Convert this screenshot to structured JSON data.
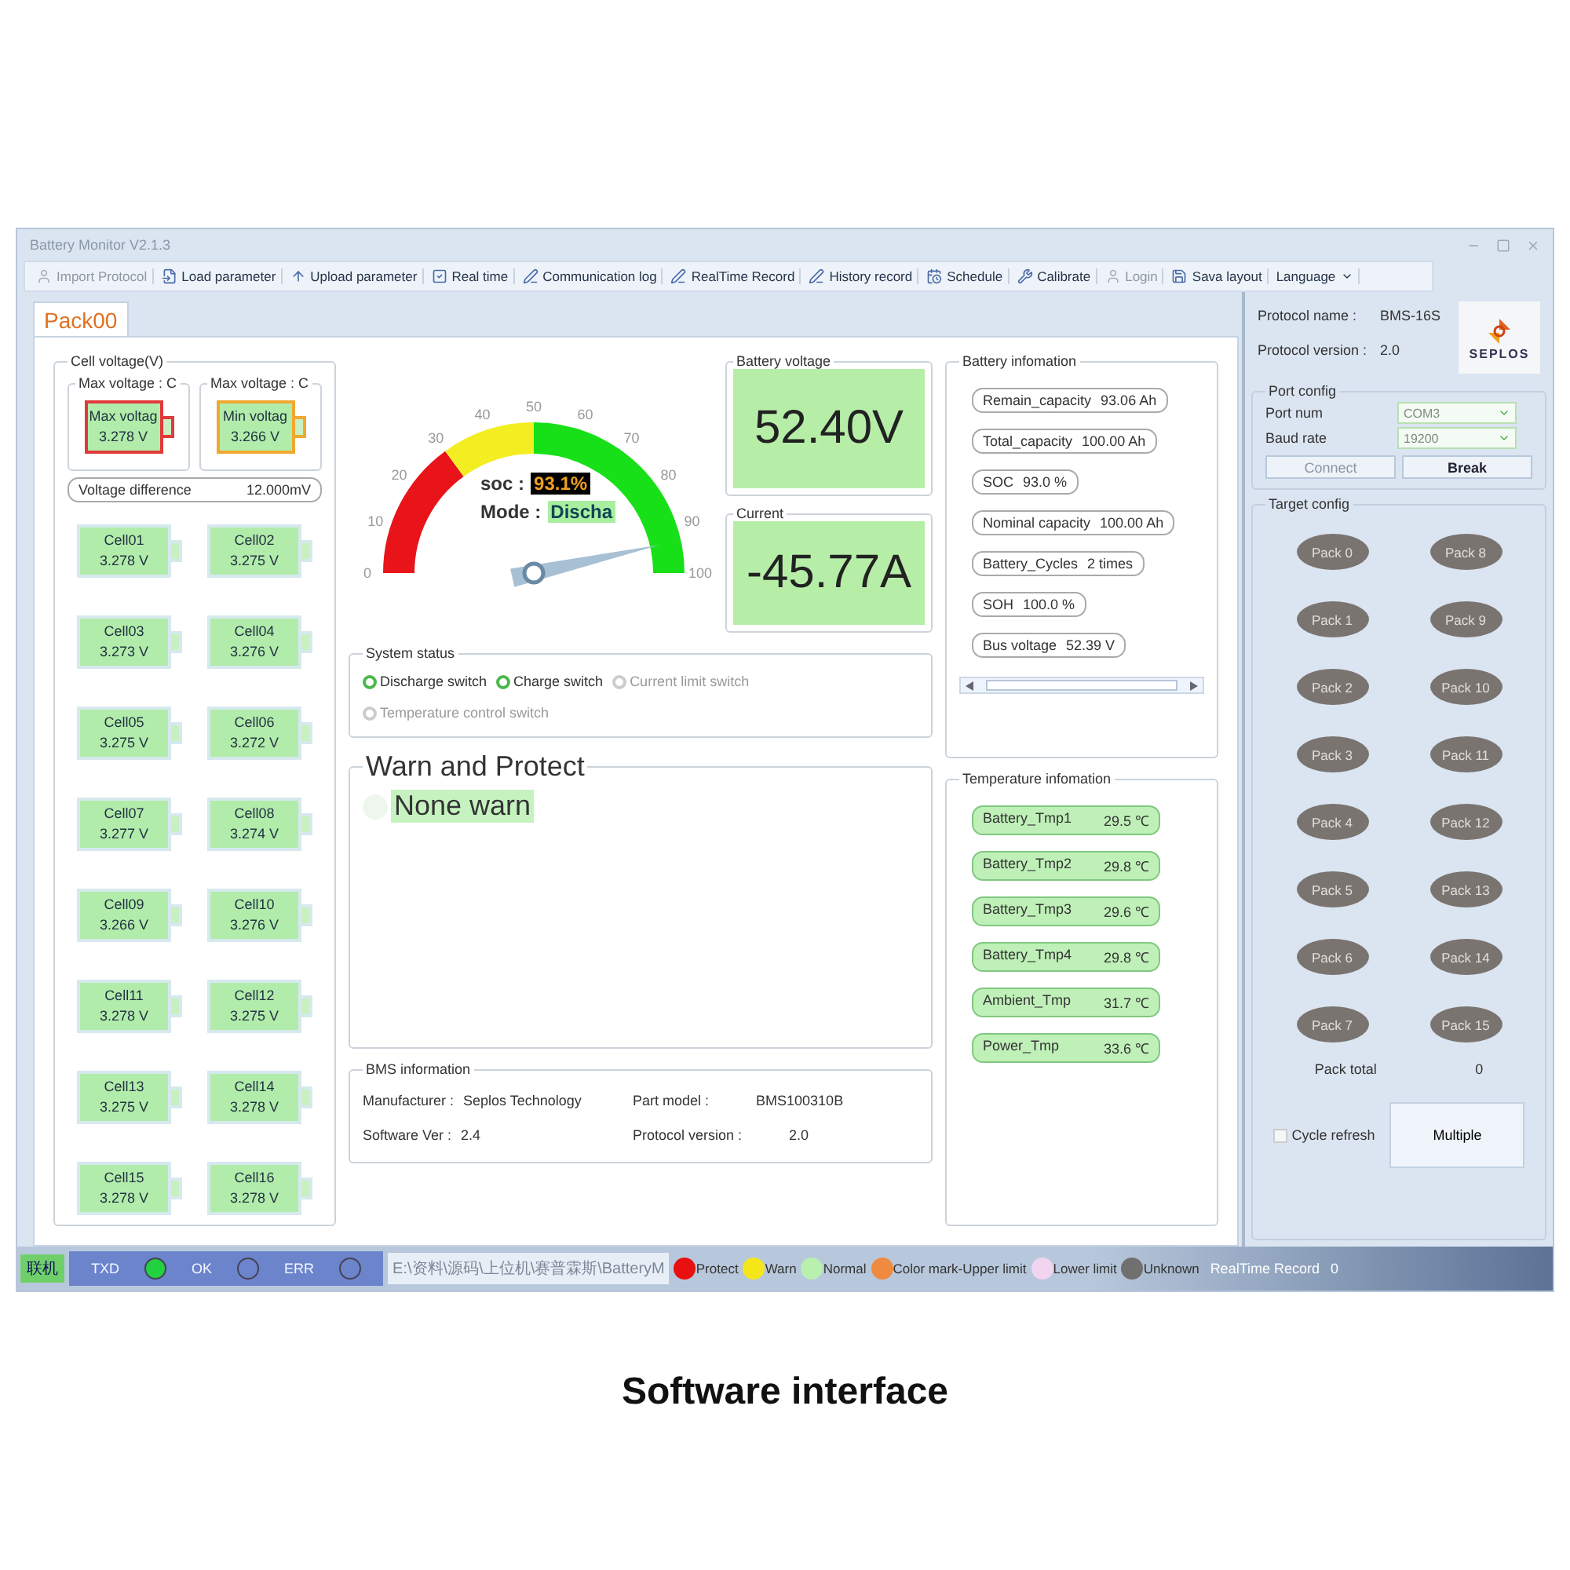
{
  "window": {
    "title": "Battery Monitor V2.1.3"
  },
  "toolbar": [
    {
      "label": "Import Protocol",
      "disabled": true
    },
    {
      "label": "Load parameter",
      "disabled": false
    },
    {
      "label": "Upload parameter",
      "disabled": false
    },
    {
      "label": "Real time",
      "disabled": false
    },
    {
      "label": "Communication log",
      "disabled": false
    },
    {
      "label": "RealTime Record",
      "disabled": false
    },
    {
      "label": "History record",
      "disabled": false
    },
    {
      "label": "Schedule",
      "disabled": false
    },
    {
      "label": "Calibrate",
      "disabled": false
    },
    {
      "label": "Login",
      "disabled": true
    },
    {
      "label": "Sava layout",
      "disabled": false
    },
    {
      "label": "Language",
      "disabled": false
    }
  ],
  "tabs": [
    {
      "label": "Pack00",
      "selected": true
    }
  ],
  "cell_voltage": {
    "title": "Cell voltage(V)",
    "extremes": [
      {
        "title": "Max voltage : C",
        "label": "Max voltag",
        "value": "3.278 V",
        "color": "#e03a3a"
      },
      {
        "title": "Max voltage : C",
        "label": "Min voltag",
        "value": "3.266 V",
        "color": "#f0a830"
      }
    ],
    "difference": {
      "label": "Voltage difference",
      "value": "12.000mV"
    },
    "cells": [
      {
        "name": "Cell01",
        "value": "3.278 V"
      },
      {
        "name": "Cell02",
        "value": "3.275 V"
      },
      {
        "name": "Cell03",
        "value": "3.273 V"
      },
      {
        "name": "Cell04",
        "value": "3.276 V"
      },
      {
        "name": "Cell05",
        "value": "3.275 V"
      },
      {
        "name": "Cell06",
        "value": "3.272 V"
      },
      {
        "name": "Cell07",
        "value": "3.277 V"
      },
      {
        "name": "Cell08",
        "value": "3.274 V"
      },
      {
        "name": "Cell09",
        "value": "3.266 V"
      },
      {
        "name": "Cell10",
        "value": "3.276 V"
      },
      {
        "name": "Cell11",
        "value": "3.278 V"
      },
      {
        "name": "Cell12",
        "value": "3.275 V"
      },
      {
        "name": "Cell13",
        "value": "3.275 V"
      },
      {
        "name": "Cell14",
        "value": "3.278 V"
      },
      {
        "name": "Cell15",
        "value": "3.278 V"
      },
      {
        "name": "Cell16",
        "value": "3.278 V"
      }
    ]
  },
  "gauge": {
    "ticks": [
      "0",
      "10",
      "20",
      "30",
      "40",
      "50",
      "60",
      "70",
      "80",
      "90",
      "100"
    ],
    "soc_label": "soc :",
    "soc": "93.1%",
    "mode_label": "Mode :",
    "mode": "Discha"
  },
  "battery_voltage": {
    "title": "Battery voltage",
    "value": "52.40V"
  },
  "current": {
    "title": "Current",
    "value": "-45.77A"
  },
  "battery_information": {
    "title": "Battery infomation",
    "rows": [
      {
        "label": "Remain_capacity",
        "value": "93.06 Ah"
      },
      {
        "label": "Total_capacity",
        "value": "100.00 Ah"
      },
      {
        "label": "SOC",
        "value": "93.0 %"
      },
      {
        "label": "Nominal capacity",
        "value": "100.00 Ah"
      },
      {
        "label": "Battery_Cycles",
        "value": "2 times"
      },
      {
        "label": "SOH",
        "value": "100.0 %"
      },
      {
        "label": "Bus voltage",
        "value": "52.39 V"
      }
    ]
  },
  "system_status": {
    "title": "System status",
    "switches": [
      {
        "label": "Discharge switch",
        "on": true
      },
      {
        "label": "Charge switch",
        "on": true
      },
      {
        "label": "Current limit switch",
        "on": false
      },
      {
        "label": "Temperature control switch",
        "on": false
      }
    ]
  },
  "warn_protect": {
    "title": "Warn and Protect",
    "items": [
      {
        "label": "None warn"
      }
    ]
  },
  "bms_information": {
    "title": "BMS information",
    "fields": [
      {
        "label": "Manufacturer :",
        "value": "Seplos Technology"
      },
      {
        "label": "Part model :",
        "value": "BMS100310B"
      },
      {
        "label": "Software Ver :",
        "value": "2.4"
      },
      {
        "label": "Protocol version :",
        "value": "2.0"
      }
    ]
  },
  "temperature_information": {
    "title": "Temperature infomation",
    "rows": [
      {
        "label": "Battery_Tmp1",
        "value": "29.5 ℃"
      },
      {
        "label": "Battery_Tmp2",
        "value": "29.8 ℃"
      },
      {
        "label": "Battery_Tmp3",
        "value": "29.6 ℃"
      },
      {
        "label": "Battery_Tmp4",
        "value": "29.8 ℃"
      },
      {
        "label": "Ambient_Tmp",
        "value": "31.7 ℃"
      },
      {
        "label": "Power_Tmp",
        "value": "33.6 ℃"
      }
    ]
  },
  "side_panel": {
    "protocol": [
      {
        "label": "Protocol name :",
        "value": "BMS-16S"
      },
      {
        "label": "Protocol version :",
        "value": "2.0"
      }
    ],
    "logo": "SEPLOS",
    "port_config": {
      "title": "Port config",
      "fields": [
        {
          "label": "Port num",
          "value": "COM3",
          "disabled": true
        },
        {
          "label": "Baud rate",
          "value": "19200",
          "disabled": true
        }
      ],
      "buttons": [
        {
          "label": "Connect",
          "disabled": true
        },
        {
          "label": "Break",
          "disabled": false
        }
      ]
    },
    "target_config": {
      "title": "Target config",
      "packs": [
        "Pack 0",
        "Pack 8",
        "Pack 1",
        "Pack 9",
        "Pack 2",
        "Pack 10",
        "Pack 3",
        "Pack 11",
        "Pack 4",
        "Pack 12",
        "Pack 5",
        "Pack 13",
        "Pack 6",
        "Pack 14",
        "Pack 7",
        "Pack 15"
      ],
      "pack_total": {
        "label": "Pack total",
        "value": "0"
      },
      "cycle_refresh": {
        "label": "Cycle refresh",
        "checked": false
      },
      "multiple": "Multiple"
    }
  },
  "status_bar": {
    "connection": "联机",
    "indicators": [
      {
        "label": "TXD",
        "on": true
      },
      {
        "label": "OK",
        "on": false
      },
      {
        "label": "ERR",
        "on": false
      }
    ],
    "path": "E:\\资料\\源码\\上位机\\赛普霖斯\\BatteryM",
    "legend": [
      {
        "label": "Protect",
        "color": "#e81010"
      },
      {
        "label": "Warn",
        "color": "#f5e61a"
      },
      {
        "label": "Normal",
        "color": "#b8f0b0"
      },
      {
        "label": "Color mark-Upper limit",
        "color": "#f08a40"
      },
      {
        "label": "Lower limit",
        "color": "#f0d4f0"
      },
      {
        "label": "Unknown",
        "color": "#707070"
      }
    ],
    "record": {
      "label": "RealTime Record",
      "value": "0"
    }
  },
  "caption": "Software interface"
}
